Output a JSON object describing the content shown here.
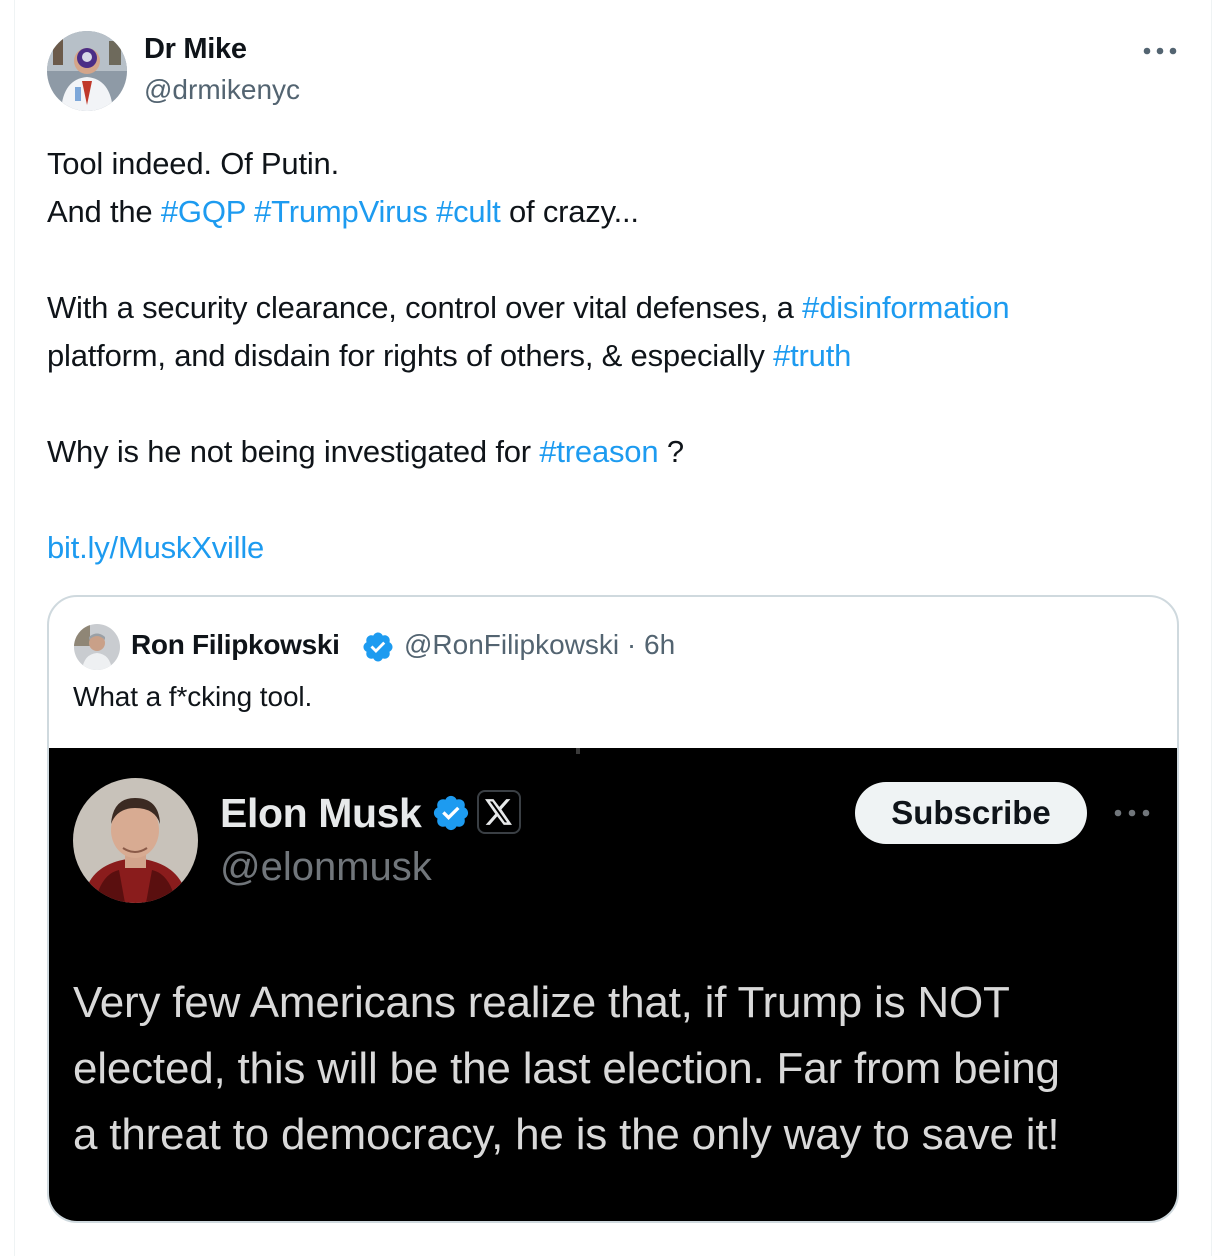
{
  "tweet": {
    "author_name": "Dr Mike",
    "author_handle": "@drmikenyc",
    "more_icon": "more-horizontal-icon",
    "line1": "Tool indeed. Of Putin.",
    "line2_pre": "And the",
    "tag_gqp": "#GQP",
    "tag_trumpvirus": "#TrumpVirus",
    "tag_cult": "#cult",
    "line2_post": "of crazy...",
    "line3_pre": "With a security clearance, control over vital defenses, a",
    "tag_disinformation": "#disinformation",
    "line4_pre": "platform, and disdain for rights of others, & especially",
    "tag_truth": "#truth",
    "line5_pre": "Why is he not being investigated for",
    "tag_treason": "#treason",
    "line5_post": "?",
    "link": "bit.ly/MuskXville"
  },
  "quote": {
    "author_name": "Ron Filipkowski",
    "verified_icon": "verified-badge-icon",
    "author_handle": "@RonFilipkowski · 6h",
    "text": "What a f*cking tool."
  },
  "embedded": {
    "author_name": "Elon Musk",
    "verified_icon": "verified-badge-icon",
    "affiliate_icon": "x-logo-icon",
    "author_handle": "@elonmusk",
    "subscribe_label": "Subscribe",
    "more_icon": "more-horizontal-icon",
    "text_line1": "Very few Americans realize that, if Trump is NOT",
    "text_line2": "elected, this will be the last election. Far from being",
    "text_line3": "a threat to democracy, he is the only way to save it!"
  },
  "colors": {
    "link_blue": "#1d9bf0",
    "secondary_text": "#536471",
    "border": "#cfd9de",
    "dark_bg": "#000000"
  }
}
